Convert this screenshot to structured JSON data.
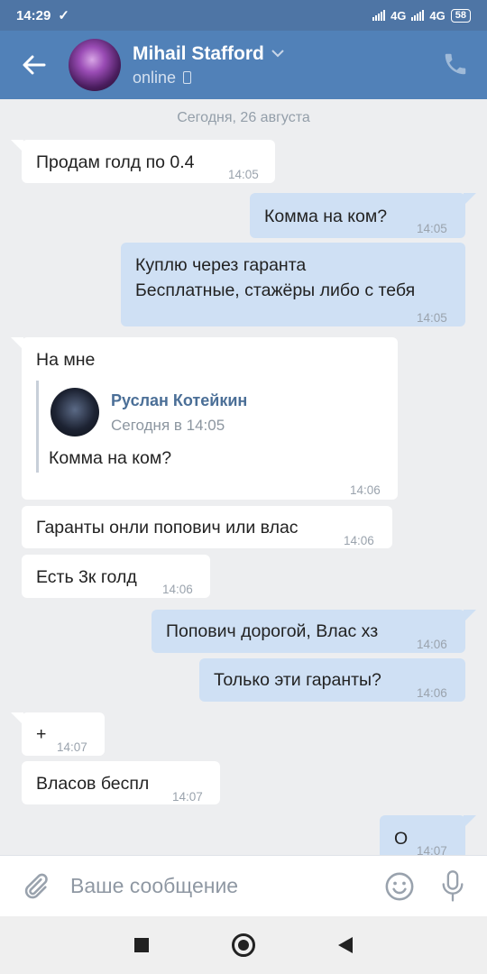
{
  "status_bar": {
    "time": "14:29",
    "network_1": "4G",
    "network_2": "4G",
    "battery": "58"
  },
  "header": {
    "name": "Mihail Stafford",
    "status": "online"
  },
  "chat": {
    "date_separator": "Сегодня, 26 августа",
    "messages": [
      {
        "dir": "in",
        "text": "Продам голд по 0.4",
        "time": "14:05"
      },
      {
        "dir": "out",
        "text": "Комма на ком?",
        "time": "14:05"
      },
      {
        "dir": "out",
        "line1": "Куплю через гаранта",
        "line2": "Бесплатные, стажёры либо с тебя",
        "time": "14:05"
      },
      {
        "dir": "in",
        "text": "На мне",
        "time": "14:06",
        "forwarded": {
          "author": "Руслан Котейкин",
          "date": "Сегодня в 14:05",
          "text": "Комма на ком?"
        }
      },
      {
        "dir": "in",
        "text": "Гаранты онли попович или влас",
        "time": "14:06"
      },
      {
        "dir": "in",
        "text": "Есть 3к голд",
        "time": "14:06"
      },
      {
        "dir": "out",
        "text": "Попович дорогой, Влас хз",
        "time": "14:06"
      },
      {
        "dir": "out",
        "text": "Только эти гаранты?",
        "time": "14:06"
      },
      {
        "dir": "in",
        "text": "+",
        "time": "14:07"
      },
      {
        "dir": "in",
        "text": "Власов беспл",
        "time": "14:07"
      },
      {
        "dir": "out",
        "text": "О",
        "time": "14:07"
      }
    ]
  },
  "input": {
    "placeholder": "Ваше сообщение"
  },
  "icons": [
    "back-arrow-icon",
    "chevron-down-icon",
    "mobile-device-icon",
    "phone-call-icon",
    "attach-clip-icon",
    "smile-icon",
    "microphone-icon"
  ],
  "colors": {
    "header": "#5181b8",
    "status_bar": "#4e75a5",
    "bubble_out": "#cfe0f4",
    "bubble_in": "#ffffff",
    "chat_bg": "#edeef0"
  }
}
